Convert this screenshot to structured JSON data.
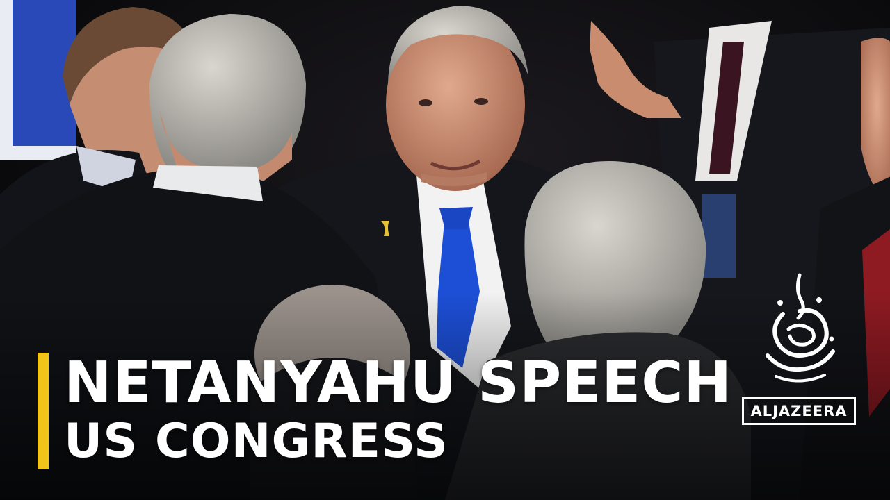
{
  "headline": {
    "line1": "NETANYAHU SPEECH",
    "line2": "US CONGRESS"
  },
  "brand": {
    "wordmark": "ALJAZEERA",
    "emblem_icon": "al-jazeera-calligraphy-logo-icon"
  },
  "colors": {
    "accent": "#f0c419",
    "headline_text": "#ffffff"
  }
}
